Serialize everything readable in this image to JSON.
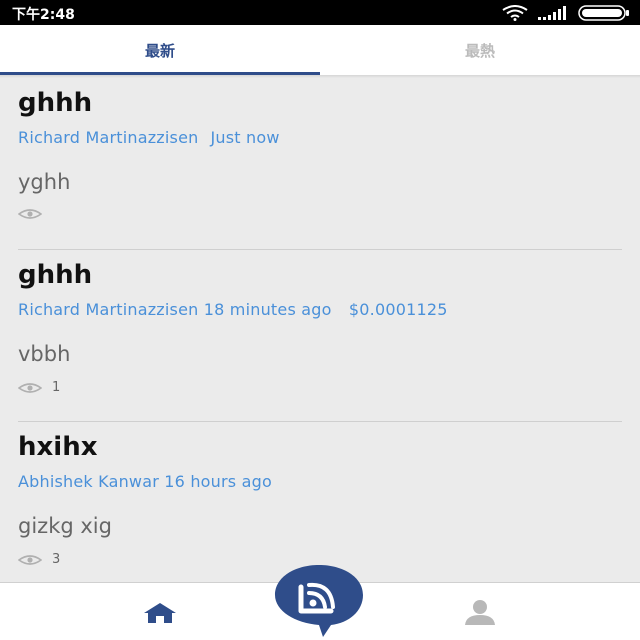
{
  "status_bar": {
    "time": "下午2:48",
    "icons": [
      "wifi-icon",
      "signal-icon",
      "battery-icon"
    ]
  },
  "tabs": [
    {
      "label": "最新",
      "active": true
    },
    {
      "label": "最熱",
      "active": false
    }
  ],
  "posts": [
    {
      "title": "ghhh",
      "author": "Richard Martinazzisen",
      "time": "Just now",
      "amount": "",
      "body": "yghh",
      "views": ""
    },
    {
      "title": "ghhh",
      "author": "Richard Martinazzisen",
      "time": "18 minutes ago",
      "amount": "$0.0001125",
      "body": "vbbh",
      "views": "1"
    },
    {
      "title": "hxihx",
      "author": "Abhishek Kanwar",
      "time": "16 hours ago",
      "amount": "",
      "body": "gizkg xig",
      "views": "3"
    }
  ],
  "bottom_nav": {
    "items": [
      "home-icon",
      "compose-feed-icon",
      "profile-icon"
    ]
  },
  "colors": {
    "accent": "#2f4d8a",
    "link": "#4a90d9",
    "background": "#ebebeb"
  }
}
